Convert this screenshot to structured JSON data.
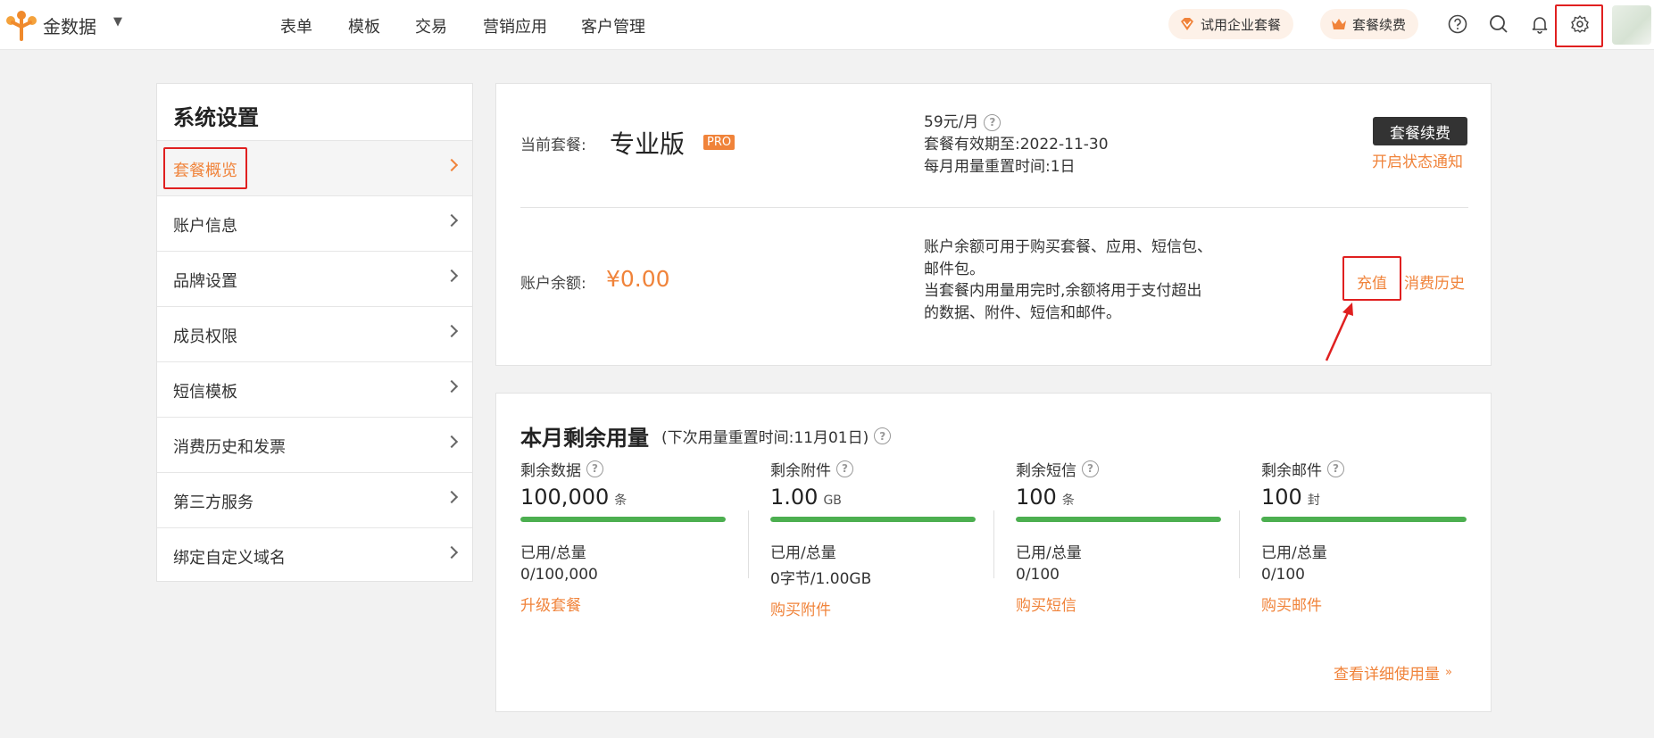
{
  "header": {
    "brand": "金数据",
    "nav": [
      "表单",
      "模板",
      "交易",
      "营销应用",
      "客户管理"
    ],
    "trial_label": "试用企业套餐",
    "renew_label": "套餐续费",
    "icons": [
      "help-circle-icon",
      "search-icon",
      "bell-icon",
      "gear-icon"
    ]
  },
  "sidebar": {
    "title": "系统设置",
    "items": [
      {
        "label": "套餐概览",
        "active": true
      },
      {
        "label": "账户信息"
      },
      {
        "label": "品牌设置"
      },
      {
        "label": "成员权限"
      },
      {
        "label": "短信模板"
      },
      {
        "label": "消费历史和发票"
      },
      {
        "label": "第三方服务"
      },
      {
        "label": "绑定自定义域名"
      }
    ]
  },
  "plan": {
    "label": "当前套餐:",
    "name": "专业版",
    "badge": "PRO",
    "price": "59元/月",
    "expiry": "套餐有效期至:2022-11-30",
    "reset": "每月用量重置时间:1日",
    "renew_button": "套餐续费",
    "notify_link": "开启状态通知"
  },
  "balance": {
    "label": "账户余额:",
    "amount": "¥0.00",
    "desc_line1": "账户余额可用于购买套餐、应用、短信包、",
    "desc_line2": "邮件包。",
    "desc_line3": "当套餐内用量用完时,余额将用于支付超出",
    "desc_line4": "的数据、附件、短信和邮件。",
    "recharge": "充值",
    "history": "消费历史"
  },
  "usage": {
    "title": "本月剩余用量",
    "subtitle": "(下次用量重置时间:11月01日)",
    "used_total_label": "已用/总量",
    "items": [
      {
        "label": "剩余数据",
        "value": "100,000",
        "unit": "条",
        "used": "0/100,000",
        "action": "升级套餐",
        "remaining_fraction": 1.0
      },
      {
        "label": "剩余附件",
        "value": "1.00",
        "unit": "GB",
        "used": "0字节/1.00GB",
        "action": "购买附件",
        "remaining_fraction": 1.0
      },
      {
        "label": "剩余短信",
        "value": "100",
        "unit": "条",
        "used": "0/100",
        "action": "购买短信",
        "remaining_fraction": 1.0
      },
      {
        "label": "剩余邮件",
        "value": "100",
        "unit": "封",
        "used": "0/100",
        "action": "购买邮件",
        "remaining_fraction": 1.0
      }
    ],
    "details_link": "查看详细使用量"
  },
  "colors": {
    "accent": "#f0833a",
    "progress": "#4caf50",
    "highlight": "#e02020"
  }
}
